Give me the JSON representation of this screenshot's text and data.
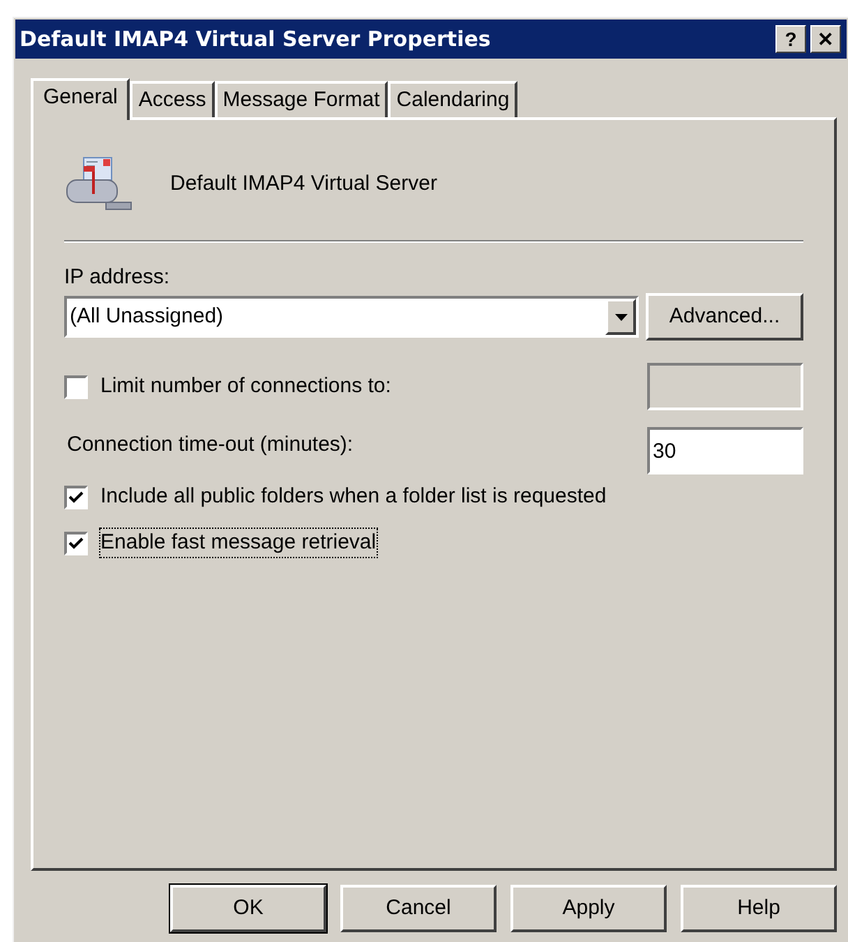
{
  "window": {
    "title": "Default IMAP4 Virtual Server Properties"
  },
  "title_buttons": [
    "?",
    "✕"
  ],
  "tabs": [
    {
      "label": "General",
      "selected": true
    },
    {
      "label": "Access",
      "selected": false
    },
    {
      "label": "Message Format",
      "selected": false
    },
    {
      "label": "Calendaring",
      "selected": false
    }
  ],
  "server_name": "Default IMAP4 Virtual Server",
  "ip_address": {
    "label": "IP address:",
    "value": "(All Unassigned)",
    "button": "Advanced..."
  },
  "limit_connections": {
    "label": "Limit number of connections to:",
    "checked": false,
    "field_disabled": true
  },
  "timeout": {
    "label": "Connection time-out (minutes):",
    "value": "30"
  },
  "options": [
    {
      "label": "Include all public folders when a folder list is requested",
      "checked": true,
      "focused": false
    },
    {
      "label": "Enable fast message retrieval",
      "checked": true,
      "focused": true
    }
  ],
  "buttons": [
    {
      "label": "OK",
      "default": true
    },
    {
      "label": "Cancel",
      "default": false
    },
    {
      "label": "Apply",
      "default": false
    },
    {
      "label": "Help",
      "default": false
    }
  ]
}
